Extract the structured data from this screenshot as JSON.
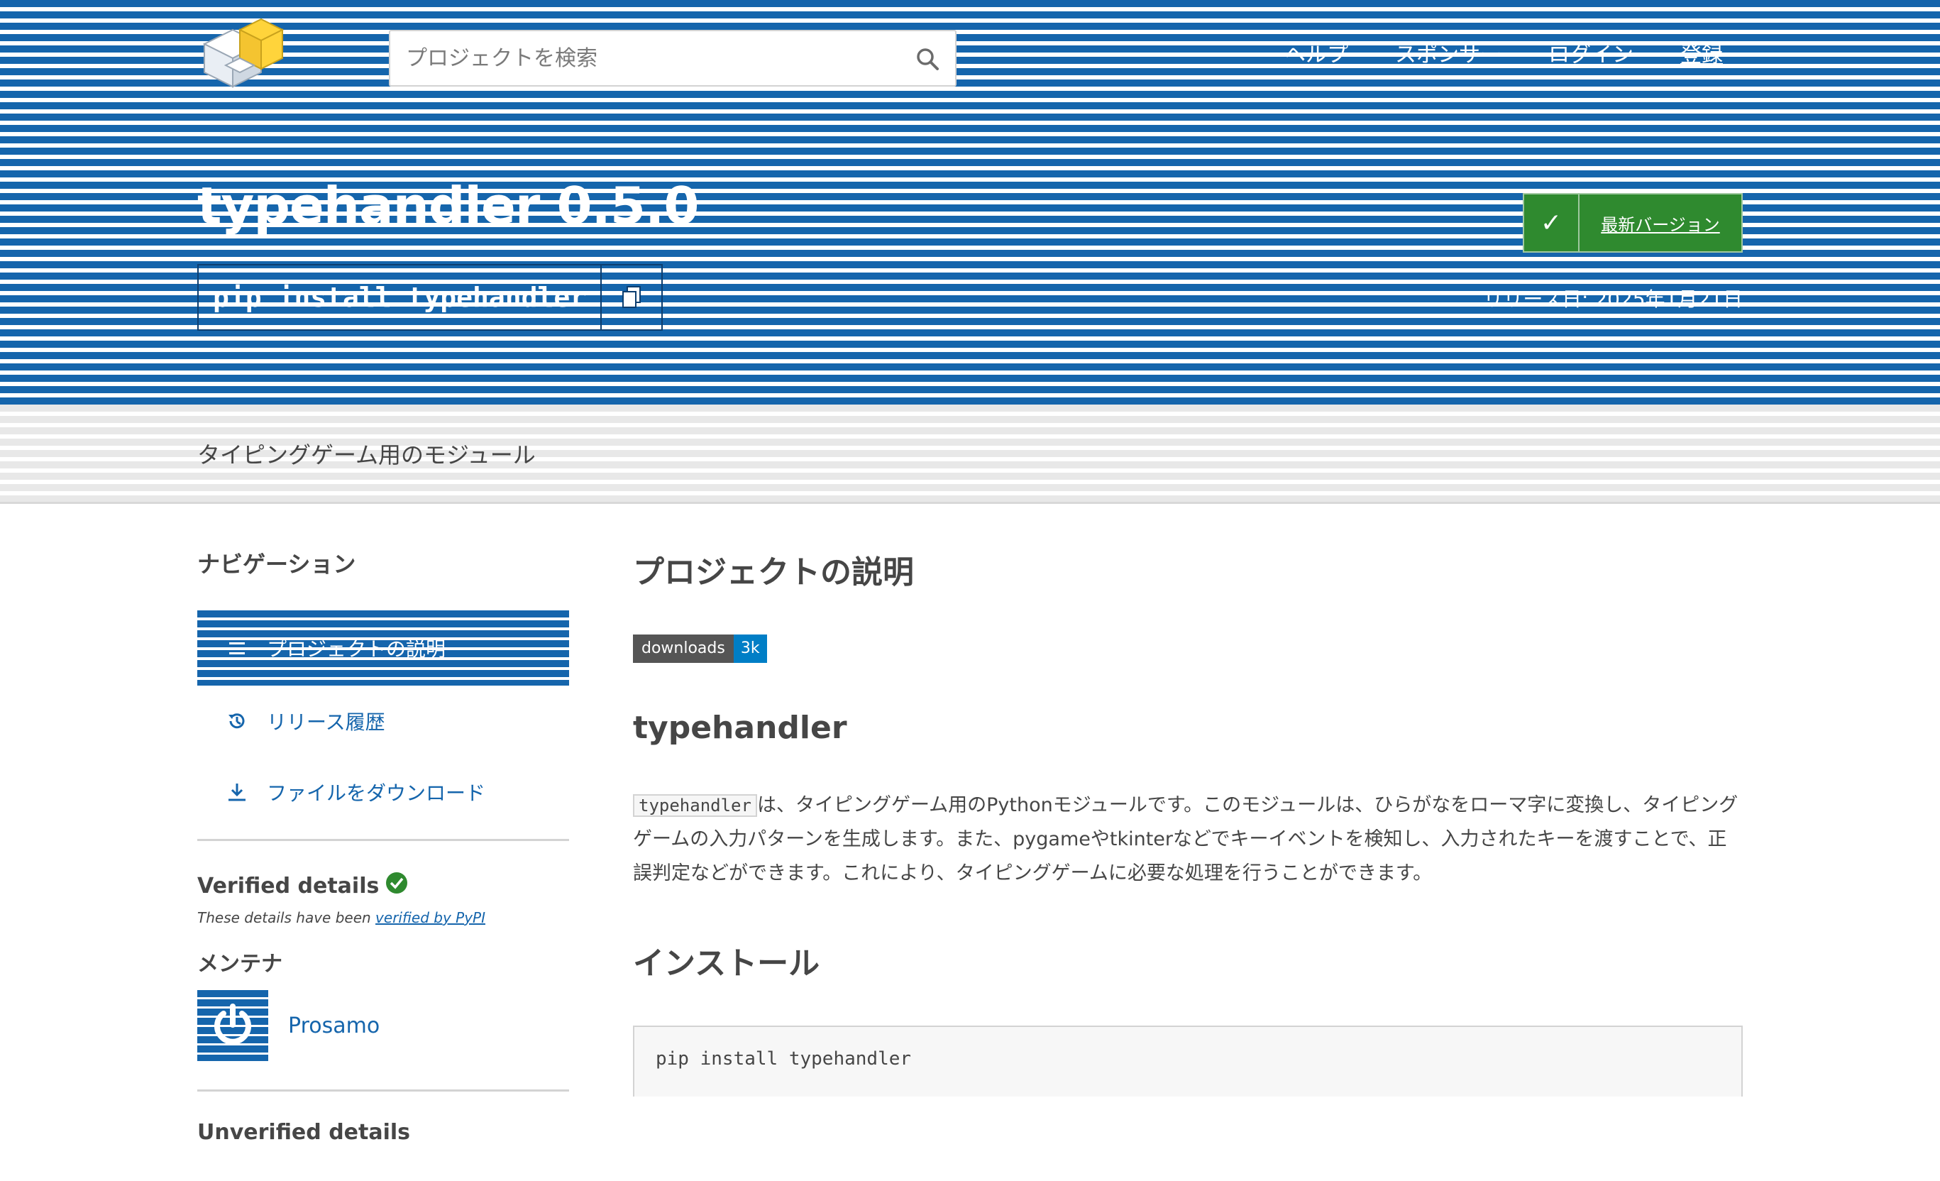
{
  "header": {
    "logo_icon": "pypi-logo-icon",
    "search_placeholder": "プロジェクトを検索",
    "nav": [
      "ヘルプ",
      "スポンサー",
      "ログイン",
      "登録"
    ]
  },
  "package": {
    "title": "typehandler 0.5.0",
    "pip_command": "pip install typehandler",
    "latest_version_label": "最新バージョン",
    "release_date": "リリース日: 2025年1月21日",
    "summary": "タイピングゲーム用のモジュール"
  },
  "sidebar": {
    "navigation_heading": "ナビゲーション",
    "items": [
      {
        "label": "プロジェクトの説明",
        "icon": "list-icon"
      },
      {
        "label": "リリース履歴",
        "icon": "history-icon"
      },
      {
        "label": "ファイルをダウンロード",
        "icon": "download-icon"
      }
    ],
    "verified_heading": "Verified details",
    "verified_note_prefix": "These details have been ",
    "verified_note_link": "verified by PyPI",
    "maintainers_heading": "メンテナ",
    "maintainer_name": "Prosamo",
    "unverified_heading": "Unverified details"
  },
  "main": {
    "description_heading": "プロジェクトの説明",
    "badge": {
      "left": "downloads",
      "right": "3k"
    },
    "readme_title": "typehandler",
    "readme_code": "typehandler",
    "readme_text": "は、タイピングゲーム用のPythonモジュールです。このモジュールは、ひらがなをローマ字に変換し、タイピングゲームの入力パターンを生成します。また、pygameやtkinterなどでキーイベントを検知し、入力されたキーを渡すことで、正誤判定などができます。これにより、タイピングゲームに必要な処理を行うことができます。",
    "install_heading": "インストール",
    "install_command": "pip install typehandler"
  },
  "colors": {
    "brand_blue": "#1565ac",
    "latest_green": "#2f8a2f",
    "link_blue": "#1565ac"
  }
}
